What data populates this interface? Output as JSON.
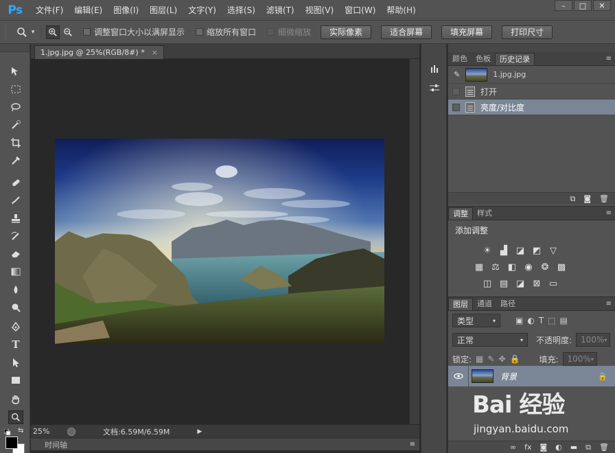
{
  "app": {
    "logo": "Ps"
  },
  "menu": [
    "文件(F)",
    "编辑(E)",
    "图像(I)",
    "图层(L)",
    "文字(Y)",
    "选择(S)",
    "滤镜(T)",
    "视图(V)",
    "窗口(W)",
    "帮助(H)"
  ],
  "window_controls": {
    "minimize": "–",
    "maximize": "□",
    "close": "✕"
  },
  "options": {
    "resize_windows": "调整窗口大小以满屏显示",
    "zoom_all": "缩放所有窗口",
    "scrubby_zoom": "细微缩放",
    "actual_pixels": "实际像素",
    "fit_screen": "适合屏幕",
    "fill_screen": "填充屏幕",
    "print_size": "打印尺寸"
  },
  "document": {
    "tab_title": "1.jpg.jpg @ 25%(RGB/8#) *",
    "close": "×",
    "zoom": "25%",
    "doc_size": "文档:6.59M/6.59M",
    "timeline": "时间轴"
  },
  "history_panel": {
    "tabs": [
      "颜色",
      "色板",
      "历史记录"
    ],
    "snapshot": "1.jpg.jpg",
    "steps": [
      "打开",
      "亮度/对比度"
    ]
  },
  "adjust_panel": {
    "tabs": [
      "调整",
      "样式"
    ],
    "title": "添加调整"
  },
  "layers_panel": {
    "tabs": [
      "图层",
      "通道",
      "路径"
    ],
    "filter_kind": "类型",
    "blend_mode": "正常",
    "opacity_label": "不透明度:",
    "opacity_value": "100%",
    "lock_label": "锁定:",
    "fill_label": "填充:",
    "fill_value": "100%",
    "layer_name": "背景"
  },
  "watermark": {
    "brand": "Bai 经验",
    "url": "jingyan.baidu.com"
  },
  "colors": {
    "ps_blue": "#31a8ff",
    "selection": "#7a8696",
    "panel": "#535353",
    "canvas_bg": "#282828"
  },
  "icons": [
    "zoom-icon",
    "zoom-in-icon",
    "zoom-out-icon",
    "move-icon",
    "marquee-icon",
    "lasso-icon",
    "quick-select-icon",
    "crop-icon",
    "eyedropper-icon",
    "healing-icon",
    "brush-icon",
    "stamp-icon",
    "history-brush-icon",
    "eraser-icon",
    "gradient-icon",
    "blur-icon",
    "dodge-icon",
    "pen-icon",
    "type-icon",
    "path-select-icon",
    "shape-icon",
    "hand-icon",
    "eye-icon",
    "lock-icon"
  ]
}
